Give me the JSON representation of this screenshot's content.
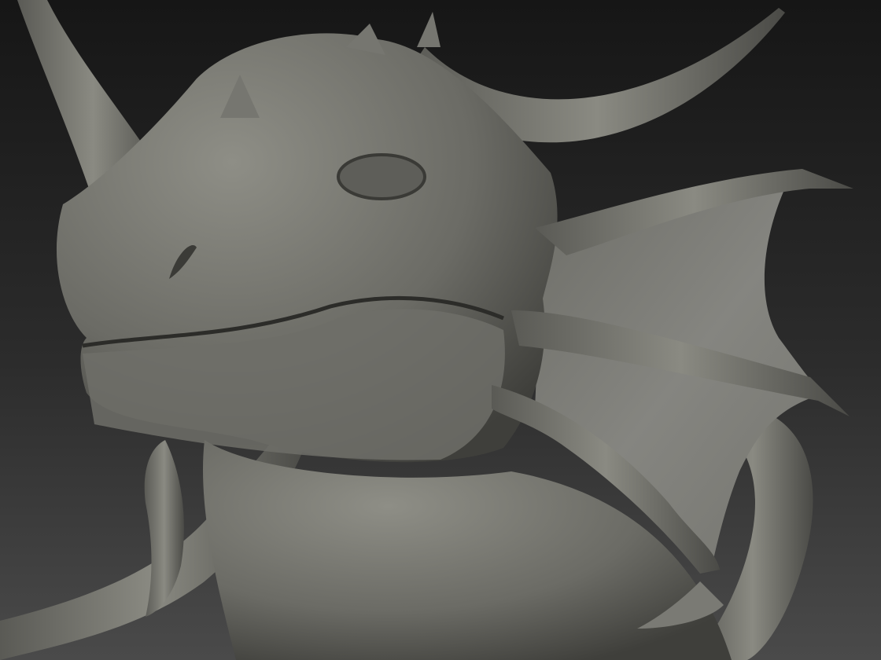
{
  "scene": {
    "subject": "dragon-head-sculpt",
    "colors": {
      "background_top": "#161616",
      "background_bottom": "#4a4a4a",
      "clay_light": "#8a8a82",
      "clay_mid": "#6b6b65",
      "clay_dark": "#3f3f3b",
      "membrane": "#7d7d76"
    }
  }
}
